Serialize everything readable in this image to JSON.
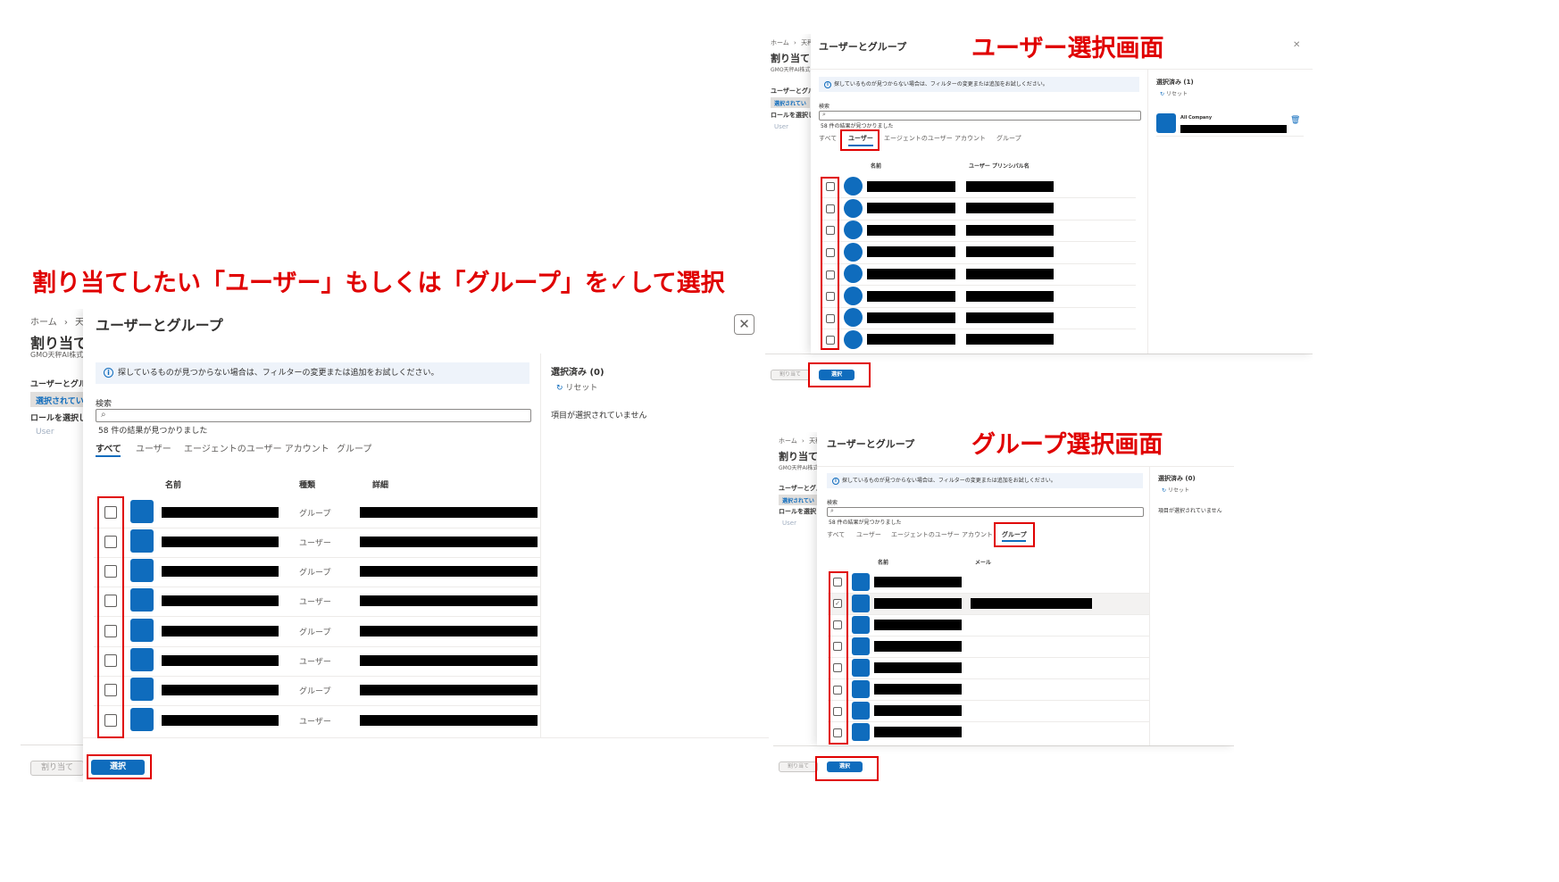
{
  "instruction": "割り当てしたい「ユーザー」もしくは「グループ」を✓して選択",
  "user_screen_caption": "ユーザー選択画面",
  "group_screen_caption": "グループ選択画面",
  "background": {
    "crumb_home": "ホーム",
    "crumb_sep": "›",
    "crumb_next": "天秤",
    "page_title": "割り当て",
    "page_sub": "GMO天秤AI株式",
    "side_heading": "ユーザーとグル",
    "side_selected": "選択されてい",
    "side_role": "ロールを選択し",
    "side_user": "User",
    "assign_button": "割り当て"
  },
  "dialog": {
    "title": "ユーザーとグループ",
    "close_icon": "close-icon",
    "info_icon": "info-icon",
    "info_text": "探しているものが見つからない場合は、フィルターの変更または追加をお試しください。",
    "search_label": "検索",
    "search_icon": "search-icon",
    "result_count": "58 件の結果が見つかりました",
    "tabs": [
      "すべて",
      "ユーザー",
      "エージェントのユーザー アカウント",
      "グループ"
    ],
    "select_button": "選択",
    "reset_label": "リセット",
    "reset_icon": "reset-icon"
  },
  "main": {
    "active_tab": "すべて",
    "columns": [
      "名前",
      "種類",
      "詳細"
    ],
    "rows": [
      {
        "kind": "グループ"
      },
      {
        "kind": "ユーザー"
      },
      {
        "kind": "グループ"
      },
      {
        "kind": "ユーザー"
      },
      {
        "kind": "グループ"
      },
      {
        "kind": "ユーザー"
      },
      {
        "kind": "グループ"
      },
      {
        "kind": "ユーザー"
      }
    ],
    "selected_heading": "選択済み (0)",
    "empty_message": "項目が選択されていません"
  },
  "user_screen": {
    "active_tab": "ユーザー",
    "columns": [
      "名前",
      "ユーザー プリンシパル名"
    ],
    "row_count": 8,
    "selected_heading": "選択済み (1)",
    "selected_item": "All Company",
    "trash_icon": "trash-icon"
  },
  "group_screen": {
    "active_tab": "グループ",
    "columns": [
      "名前",
      "メール"
    ],
    "row_count": 8,
    "checked_row": 2,
    "selected_heading": "選択済み (0)",
    "empty_message": "項目が選択されていません"
  },
  "colors": {
    "accent": "#0f6cbd",
    "annotation_red": "#e00000",
    "redaction": "#000000"
  }
}
